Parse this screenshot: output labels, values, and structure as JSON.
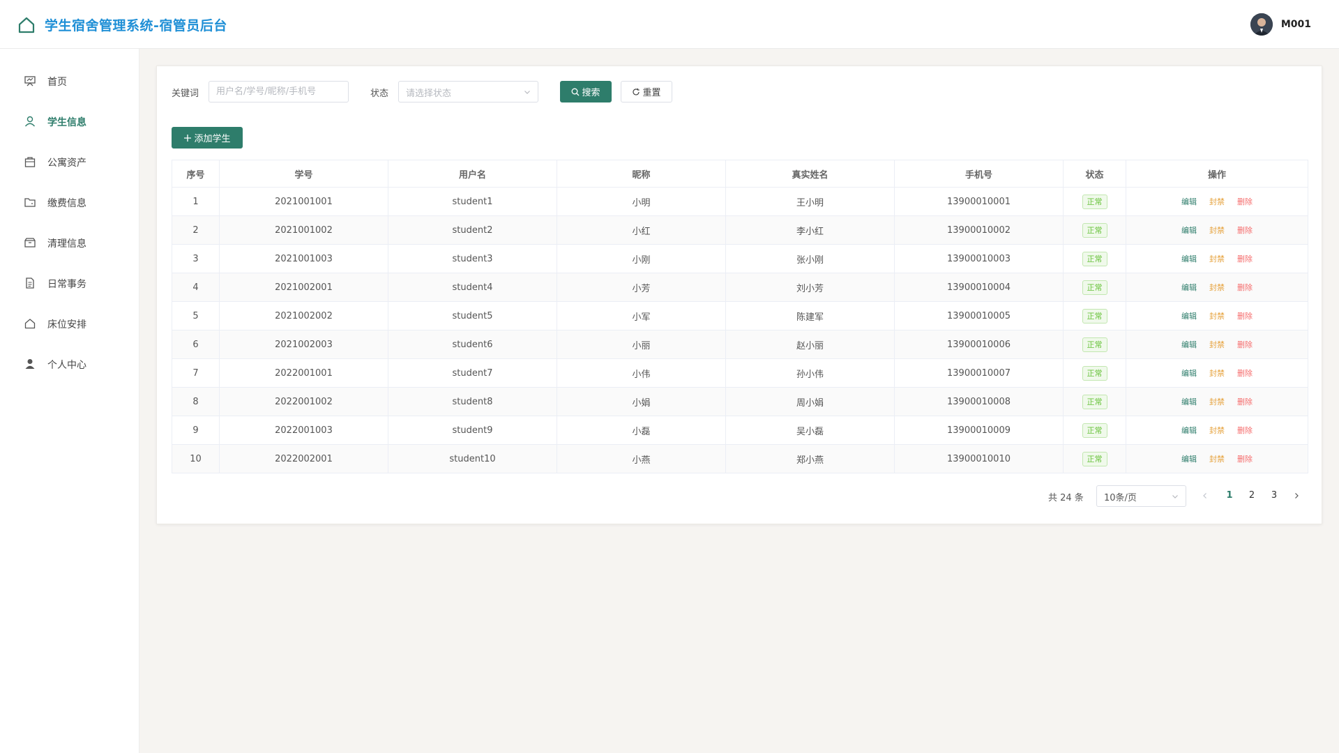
{
  "header": {
    "title": "学生宿舍管理系统-宿管员后台",
    "username": "M001"
  },
  "sidebar": {
    "items": [
      {
        "label": "首页",
        "icon": "dashboard-icon"
      },
      {
        "label": "学生信息",
        "icon": "user-icon",
        "active": true
      },
      {
        "label": "公寓资产",
        "icon": "bag-icon"
      },
      {
        "label": "缴费信息",
        "icon": "folder-icon"
      },
      {
        "label": "清理信息",
        "icon": "box-icon"
      },
      {
        "label": "日常事务",
        "icon": "document-icon"
      },
      {
        "label": "床位安排",
        "icon": "home-icon"
      },
      {
        "label": "个人中心",
        "icon": "person-icon"
      }
    ]
  },
  "filters": {
    "keyword_label": "关键词",
    "keyword_placeholder": "用户名/学号/昵称/手机号",
    "status_label": "状态",
    "status_placeholder": "请选择状态",
    "search_label": "搜索",
    "reset_label": "重置"
  },
  "add_button_label": "添加学生",
  "table": {
    "columns": [
      "序号",
      "学号",
      "用户名",
      "昵称",
      "真实姓名",
      "手机号",
      "状态",
      "操作"
    ],
    "actions": {
      "edit": "编辑",
      "ban": "封禁",
      "delete": "删除"
    },
    "rows": [
      [
        "1",
        "2021001001",
        "student1",
        "小明",
        "王小明",
        "13900010001",
        "正常"
      ],
      [
        "2",
        "2021001002",
        "student2",
        "小红",
        "李小红",
        "13900010002",
        "正常"
      ],
      [
        "3",
        "2021001003",
        "student3",
        "小刚",
        "张小刚",
        "13900010003",
        "正常"
      ],
      [
        "4",
        "2021002001",
        "student4",
        "小芳",
        "刘小芳",
        "13900010004",
        "正常"
      ],
      [
        "5",
        "2021002002",
        "student5",
        "小军",
        "陈建军",
        "13900010005",
        "正常"
      ],
      [
        "6",
        "2021002003",
        "student6",
        "小丽",
        "赵小丽",
        "13900010006",
        "正常"
      ],
      [
        "7",
        "2022001001",
        "student7",
        "小伟",
        "孙小伟",
        "13900010007",
        "正常"
      ],
      [
        "8",
        "2022001002",
        "student8",
        "小娟",
        "周小娟",
        "13900010008",
        "正常"
      ],
      [
        "9",
        "2022001003",
        "student9",
        "小磊",
        "吴小磊",
        "13900010009",
        "正常"
      ],
      [
        "10",
        "2022002001",
        "student10",
        "小燕",
        "郑小燕",
        "13900010010",
        "正常"
      ]
    ]
  },
  "pagination": {
    "total_label": "共 24 条",
    "page_size": "10条/页",
    "pages": [
      "1",
      "2",
      "3"
    ],
    "current": "1"
  },
  "colors": {
    "primary": "#2e7d6b",
    "title": "#1f8fd6",
    "ban": "#e6a23c",
    "delete": "#f56c6c",
    "status_ok": "#67c23a"
  }
}
